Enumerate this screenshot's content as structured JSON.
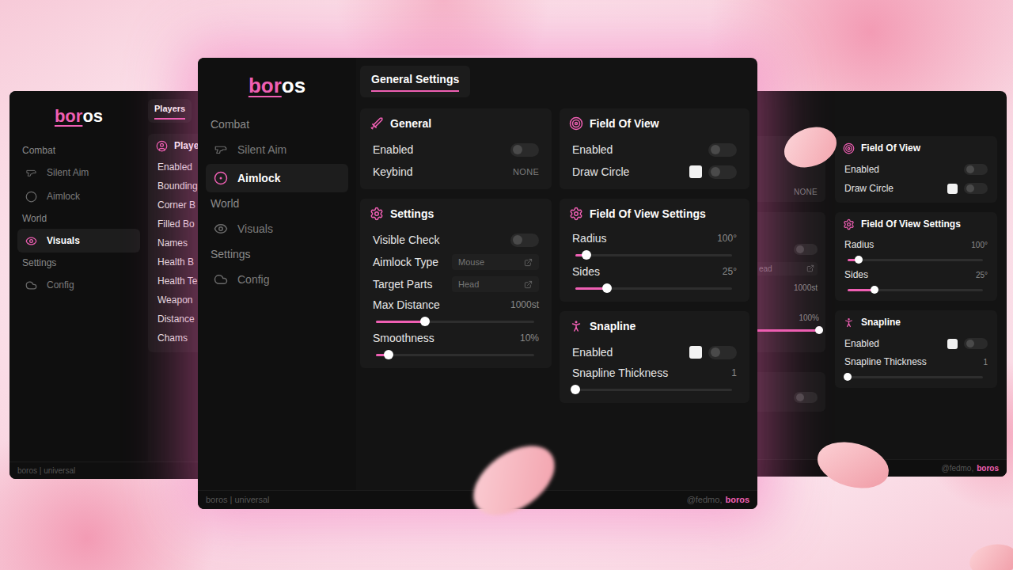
{
  "main_window": {
    "logo": {
      "accent": "bor",
      "rest": "os"
    },
    "nav": [
      {
        "section": "Combat",
        "items": [
          {
            "label": "Silent Aim",
            "selected": false
          },
          {
            "label": "Aimlock",
            "selected": true
          }
        ]
      },
      {
        "section": "World",
        "items": [
          {
            "label": "Visuals",
            "selected": false
          }
        ]
      },
      {
        "section": "Settings",
        "items": [
          {
            "label": "Config",
            "selected": false
          }
        ]
      }
    ],
    "tabs": [
      {
        "label": "General Settings",
        "selected": true
      }
    ],
    "columns": [
      [
        {
          "title": "General",
          "rows": [
            {
              "kind": "toggle",
              "label": "Enabled",
              "on": false
            },
            {
              "kind": "keybind",
              "label": "Keybind",
              "value": "NONE"
            }
          ]
        },
        {
          "title": "Settings",
          "rows": [
            {
              "kind": "toggle",
              "label": "Visible Check",
              "on": false
            },
            {
              "kind": "dropdown",
              "label": "Aimlock Type",
              "value": "Mouse"
            },
            {
              "kind": "dropdown",
              "label": "Target Parts",
              "value": "Head"
            },
            {
              "kind": "slider",
              "label": "Max Distance",
              "reading": "1000st",
              "level": 0.31
            },
            {
              "kind": "slider",
              "label": "Smoothness",
              "reading": "10%",
              "level": 0.08
            }
          ]
        }
      ],
      [
        {
          "title": "Field Of View",
          "rows": [
            {
              "kind": "toggle",
              "label": "Enabled",
              "on": false
            },
            {
              "kind": "swatch-toggle",
              "label": "Draw Circle",
              "color": "#f2f2f2",
              "on": false
            }
          ]
        },
        {
          "title": "Field Of View Settings",
          "rows": [
            {
              "kind": "slider",
              "label": "Radius",
              "reading": "100°",
              "level": 0.07
            },
            {
              "kind": "slider",
              "label": "Sides",
              "reading": "25°",
              "level": 0.2
            }
          ]
        },
        {
          "title": "Snapline",
          "rows": [
            {
              "kind": "swatch-toggle",
              "label": "Enabled",
              "color": "#f2f2f2",
              "on": false
            },
            {
              "kind": "slider",
              "label": "Snapline Thickness",
              "reading": "1",
              "level": 0
            }
          ]
        }
      ]
    ],
    "footer": {
      "left": "boros | universal",
      "user": "@fedmo,",
      "brand": "boros"
    }
  },
  "left_window": {
    "logo": {
      "accent": "bor",
      "rest": "os"
    },
    "nav": [
      {
        "section": "Combat",
        "items": [
          {
            "label": "Silent Aim",
            "selected": false
          },
          {
            "label": "Aimlock",
            "selected": false
          }
        ]
      },
      {
        "section": "World",
        "items": [
          {
            "label": "Visuals",
            "selected": true
          }
        ]
      },
      {
        "section": "Settings",
        "items": [
          {
            "label": "Config",
            "selected": false
          }
        ]
      }
    ],
    "tabs": [
      {
        "label": "Players",
        "selected": true
      }
    ],
    "card": {
      "title": "Playe",
      "rows": [
        {
          "kind": "label",
          "label": "Enabled"
        },
        {
          "kind": "label",
          "label": "Bounding"
        },
        {
          "kind": "label",
          "label": "Corner B"
        },
        {
          "kind": "label",
          "label": "Filled Bo"
        },
        {
          "kind": "label",
          "label": "Names"
        },
        {
          "kind": "label",
          "label": "Health B"
        },
        {
          "kind": "label",
          "label": "Health Te"
        },
        {
          "kind": "label",
          "label": "Weapon"
        },
        {
          "kind": "label",
          "label": "Distance"
        },
        {
          "kind": "label",
          "label": "Chams"
        }
      ]
    },
    "footer": {
      "left": "boros | universal"
    }
  },
  "right_window": {
    "partial_cards": [
      {
        "rows": [
          {
            "kind": "keybind",
            "value": "NONE"
          }
        ]
      },
      {
        "rows": [
          {
            "kind": "toggle",
            "on": false
          },
          {
            "kind": "dropdown",
            "value": "ead"
          },
          {
            "kind": "value",
            "reading": "1000st"
          },
          {
            "kind": "slider",
            "reading": "100%",
            "level": 1
          }
        ]
      },
      {
        "rows": [
          {
            "kind": "toggle",
            "on": false
          }
        ]
      }
    ],
    "cards": [
      {
        "title": "Field Of View",
        "rows": [
          {
            "kind": "toggle",
            "label": "Enabled",
            "on": false
          },
          {
            "kind": "swatch-toggle",
            "label": "Draw Circle",
            "color": "#f2f2f2",
            "on": false
          }
        ]
      },
      {
        "title": "Field Of View Settings",
        "rows": [
          {
            "kind": "slider",
            "label": "Radius",
            "reading": "100°",
            "level": 0.08
          },
          {
            "kind": "slider",
            "label": "Sides",
            "reading": "25°",
            "level": 0.2
          }
        ]
      },
      {
        "title": "Snapline",
        "rows": [
          {
            "kind": "swatch-toggle",
            "label": "Enabled",
            "color": "#f2f2f2",
            "on": false
          },
          {
            "kind": "slider",
            "label": "Snapline Thickness",
            "reading": "1",
            "level": 0
          }
        ]
      }
    ],
    "footer": {
      "user": "@fedmo,",
      "brand": "boros"
    }
  }
}
